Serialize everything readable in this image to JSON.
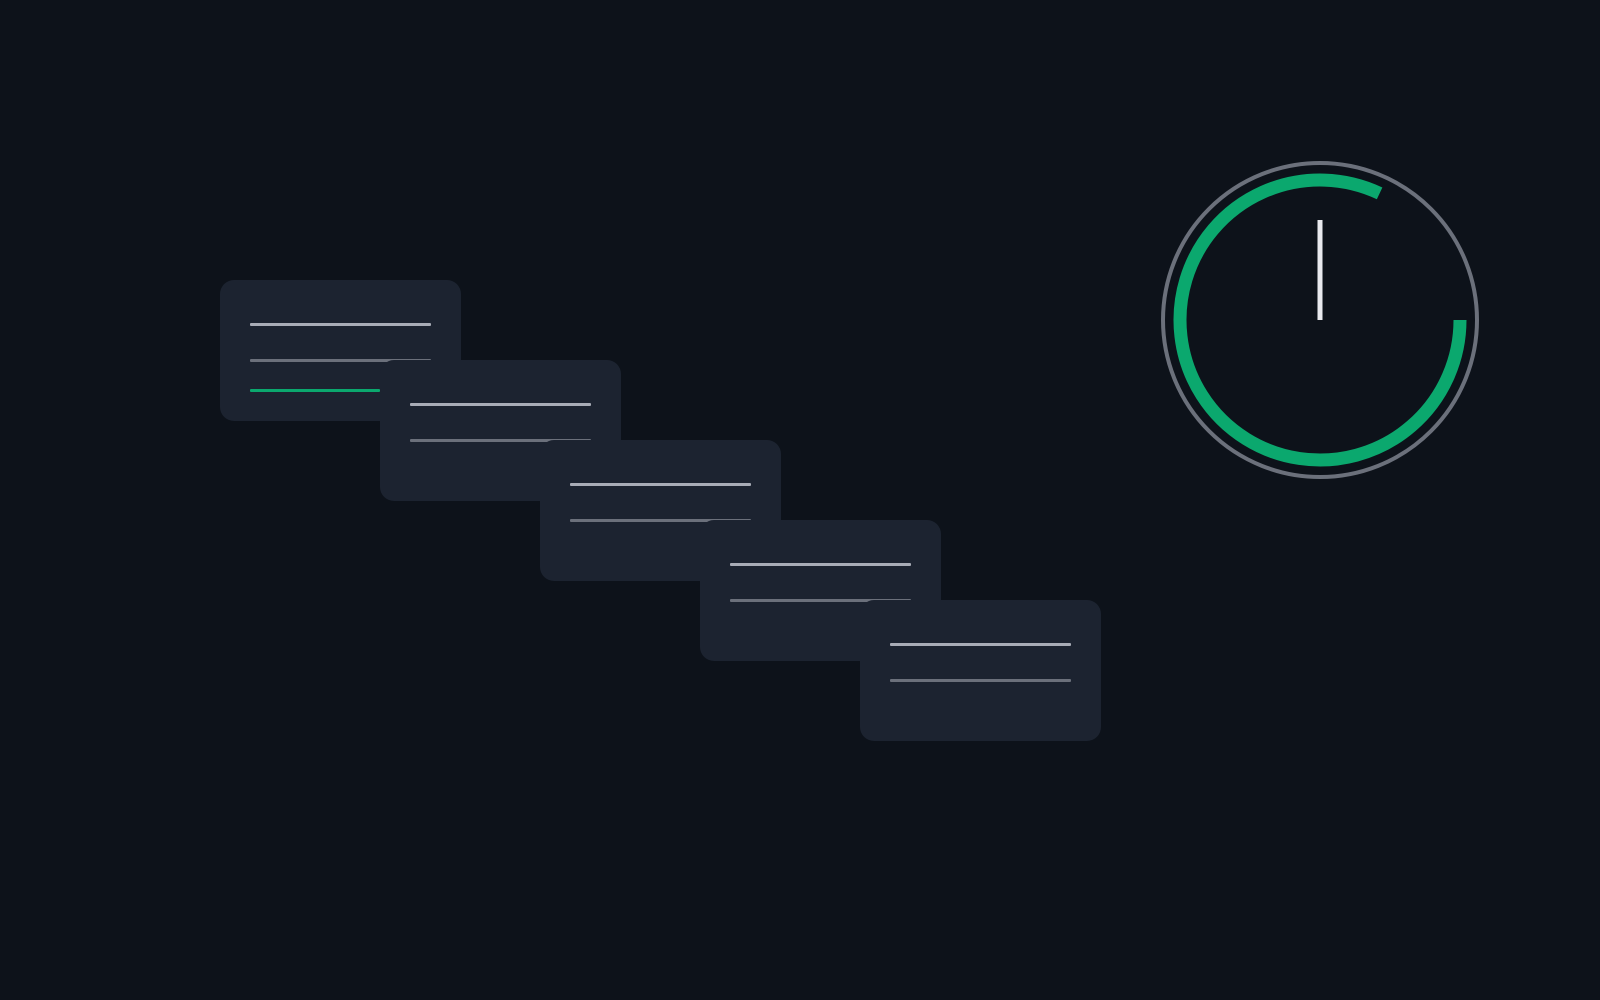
{
  "colors": {
    "background": "#0d121a",
    "card": "#1c2330",
    "title_line": "#a8acb6",
    "sub_line": "#6b707b",
    "accent": "#0ba86e",
    "ring": "#6b707b",
    "hand": "#e8e9ee"
  },
  "cards": [
    {
      "progress": 0.72
    },
    {
      "progress": 0
    },
    {
      "progress": 0
    },
    {
      "progress": 0
    },
    {
      "progress": 0
    }
  ],
  "timer": {
    "progress_arc_icon": "progress-ring-icon",
    "arc_start_fraction": 0.25,
    "arc_end_fraction": 1.07,
    "hand_angle_deg": 0
  }
}
